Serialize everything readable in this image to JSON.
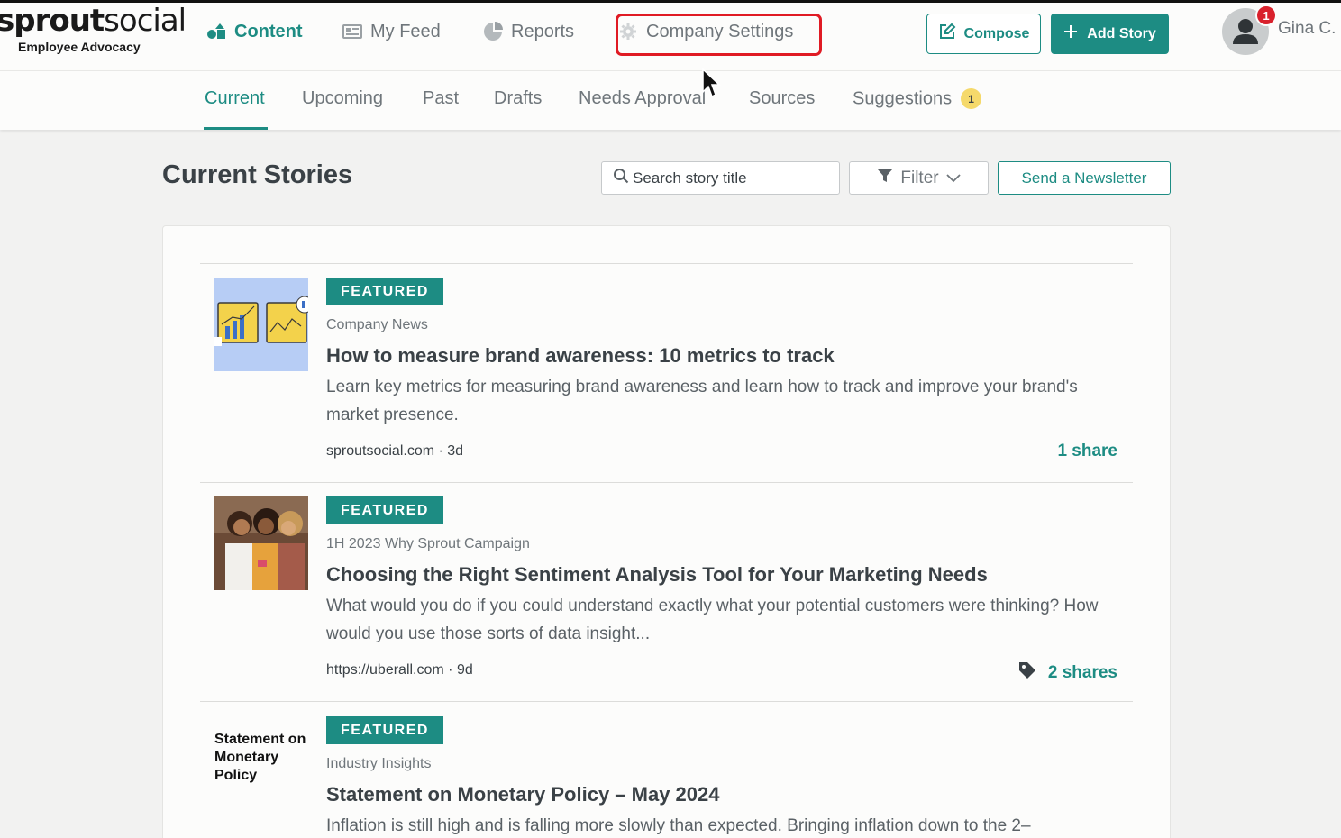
{
  "logo": {
    "brand_bold": "sprout",
    "brand_light": "social",
    "subtitle": "Employee Advocacy"
  },
  "nav": {
    "items": [
      {
        "label": "Content",
        "icon": "content-icon"
      },
      {
        "label": "My Feed",
        "icon": "feed-icon"
      },
      {
        "label": "Reports",
        "icon": "reports-icon"
      },
      {
        "label": "Company Settings",
        "icon": "gear-icon"
      }
    ],
    "compose_label": "Compose",
    "add_story_label": "Add Story"
  },
  "user": {
    "name": "Gina C.",
    "notification_count": "1"
  },
  "tabs": [
    {
      "label": "Current"
    },
    {
      "label": "Upcoming"
    },
    {
      "label": "Past"
    },
    {
      "label": "Drafts"
    },
    {
      "label": "Needs Approval"
    },
    {
      "label": "Sources"
    },
    {
      "label": "Suggestions",
      "badge": "1"
    }
  ],
  "page": {
    "title": "Current Stories",
    "search_placeholder": "Search story title",
    "filter_label": "Filter",
    "newsletter_label": "Send a Newsletter"
  },
  "stories": [
    {
      "badge": "FEATURED",
      "category": "Company News",
      "title": "How to measure brand awareness: 10 metrics to track",
      "description": "Learn key metrics for measuring brand awareness and learn how to track and improve your brand's market presence.",
      "source": "sproutsocial.com · 3d",
      "shares": "1 share"
    },
    {
      "badge": "FEATURED",
      "category": "1H 2023 Why Sprout Campaign",
      "title": "Choosing the Right Sentiment Analysis Tool for Your Marketing Needs",
      "description": "What would you do if you could understand exactly what your potential customers were thinking? How would you use those sorts of data insight...",
      "source": "https://uberall.com · 9d",
      "shares": "2 shares"
    },
    {
      "badge": "FEATURED",
      "category": "Industry Insights",
      "title": "Statement on Monetary Policy – May 2024",
      "description": "Inflation is still high and is falling more slowly than expected. Bringing inflation down to the 2–",
      "thumb_text": "Statement on Monetary Policy"
    }
  ],
  "colors": {
    "accent": "#1d8c83",
    "highlight": "#e01b24",
    "badge_yellow": "#f5d96b",
    "notification": "#d9212c"
  }
}
